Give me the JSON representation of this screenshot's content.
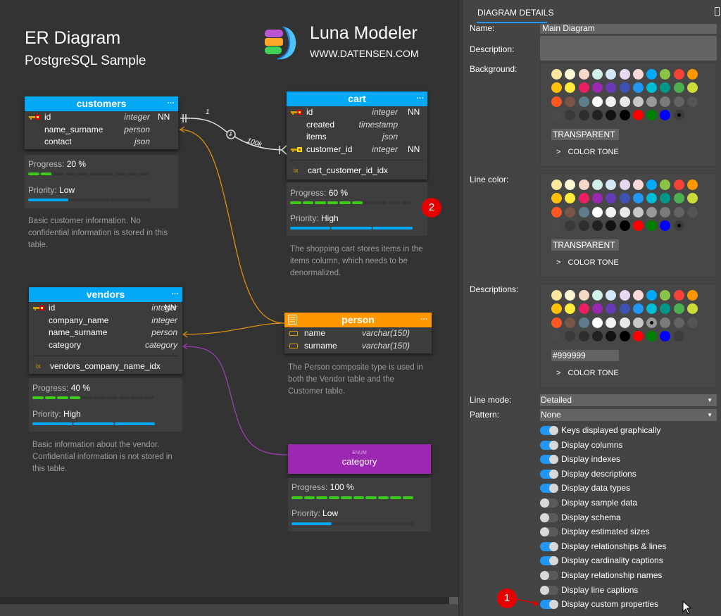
{
  "diagram": {
    "title": "ER Diagram",
    "subtitle": "PostgreSQL Sample",
    "logo_title": "Luna Modeler",
    "logo_url": "WWW.DATENSEN.COM"
  },
  "entities": {
    "customers": {
      "name": "customers",
      "more": "…",
      "columns": [
        {
          "name": "id",
          "type": "integer",
          "nn": "NN",
          "key": "pk"
        },
        {
          "name": "name_surname",
          "type": "person",
          "nn": "",
          "key": ""
        },
        {
          "name": "contact",
          "type": "json",
          "nn": "",
          "key": ""
        }
      ],
      "progress_label": "Progress:",
      "progress_value": "20 %",
      "progress": 0.2,
      "priority_label": "Priority:",
      "priority_value": "Low",
      "priority_level": 1,
      "description": "Basic customer information. No confidential information is stored in this table."
    },
    "cart": {
      "name": "cart",
      "more": "…",
      "columns": [
        {
          "name": "id",
          "type": "integer",
          "nn": "NN",
          "key": "pk"
        },
        {
          "name": "created",
          "type": "timestamp",
          "nn": "",
          "key": ""
        },
        {
          "name": "items",
          "type": "json",
          "nn": "",
          "key": ""
        },
        {
          "name": "customer_id",
          "type": "integer",
          "nn": "NN",
          "key": "fk"
        }
      ],
      "index": "cart_customer_id_idx",
      "index_icon": "ix",
      "progress_label": "Progress:",
      "progress_value": "60 %",
      "progress": 0.6,
      "priority_label": "Priority:",
      "priority_value": "High",
      "priority_level": 3,
      "description": "The shopping cart stores items in the items column, which needs to be denormalized."
    },
    "vendors": {
      "name": "vendors",
      "more": "…",
      "columns": [
        {
          "name": "id",
          "type": "integer",
          "nn": "NN",
          "key": "pk"
        },
        {
          "name": "company_name",
          "type": "integer",
          "nn": "",
          "key": ""
        },
        {
          "name": "name_surname",
          "type": "person",
          "nn": "",
          "key": ""
        },
        {
          "name": "category",
          "type": "category",
          "nn": "",
          "key": ""
        }
      ],
      "index": "vendors_company_name_idx",
      "index_icon": "ix",
      "progress_label": "Progress:",
      "progress_value": "40 %",
      "progress": 0.4,
      "priority_label": "Priority:",
      "priority_value": "High",
      "priority_level": 3,
      "description": "Basic information about the vendor. Confidential information is not stored in this table."
    },
    "person": {
      "name": "person",
      "more": "…",
      "columns": [
        {
          "name": "name",
          "type": "varchar(150)"
        },
        {
          "name": "surname",
          "type": "varchar(150)"
        }
      ],
      "description": "The Person composite type is used in both the Vendor table and the Customer table."
    },
    "category": {
      "kind": "ENUM",
      "name": "category",
      "progress_label": "Progress:",
      "progress_value": "100 %",
      "progress": 1.0,
      "priority_label": "Priority:",
      "priority_value": "Low",
      "priority_level": 1
    }
  },
  "relationship": {
    "cardinality_parent": "1",
    "cardinality_child": "100k"
  },
  "badges": [
    "1",
    "2"
  ],
  "panel": {
    "tab": "DIAGRAM DETAILS",
    "name_label": "Name:",
    "name_value": "Main Diagram",
    "description_label": "Description:",
    "description_value": "",
    "background_label": "Background:",
    "background_hex": "TRANSPARENT",
    "line_color_label": "Line color:",
    "line_color_hex": "TRANSPARENT",
    "descriptions_label": "Descriptions:",
    "descriptions_hex": "#999999",
    "color_tone": "COLOR TONE",
    "palette": [
      "#f9e79f",
      "#fdf5d4",
      "#f6d8c8",
      "#d0f0e8",
      "#d4e8f8",
      "#e6d8f0",
      "#f8d8d8",
      "#03a9f4",
      "#8bc34a",
      "#f44336",
      "#ff9800",
      "#ffc107",
      "#ffeb3b",
      "#e91e63",
      "#9c27b0",
      "#673ab7",
      "#3f51b5",
      "#2196f3",
      "#00bcd4",
      "#009688",
      "#4caf50",
      "#cddc39",
      "#ff5722",
      "#795548",
      "#607d8b",
      "#ffffff",
      "#f2f2f2",
      "#e8e8e8",
      "#c8c8c8",
      "#999999",
      "#7a7a7a",
      "#626262",
      "#545454",
      "#4a4a4a",
      "#3a3a3a",
      "#2e2e2e",
      "#222222",
      "#111111",
      "#000000",
      "#ff0000",
      "#008000",
      "#0000ff",
      "#3c3c3c"
    ],
    "line_mode_label": "Line mode:",
    "line_mode_value": "Detailed",
    "pattern_label": "Pattern:",
    "pattern_value": "None",
    "toggles": [
      {
        "label": "Keys displayed graphically",
        "on": true
      },
      {
        "label": "Display columns",
        "on": true
      },
      {
        "label": "Display indexes",
        "on": true
      },
      {
        "label": "Display descriptions",
        "on": true
      },
      {
        "label": "Display data types",
        "on": true
      },
      {
        "label": "Display sample data",
        "on": false
      },
      {
        "label": "Display schema",
        "on": false
      },
      {
        "label": "Display estimated sizes",
        "on": false
      },
      {
        "label": "Display relationships & lines",
        "on": true
      },
      {
        "label": "Display cardinality captions",
        "on": true
      },
      {
        "label": "Display relationship names",
        "on": false
      },
      {
        "label": "Display line captions",
        "on": false
      },
      {
        "label": "Display custom properties",
        "on": true
      }
    ]
  },
  "colors": {
    "table_header": "#03a9f4",
    "composite_header": "#ff9800",
    "enum_header": "#9c27b0",
    "progress": "#3ecc1a",
    "priority": "#03a9f4",
    "accent": "#2196f3",
    "badge": "#e60000"
  }
}
